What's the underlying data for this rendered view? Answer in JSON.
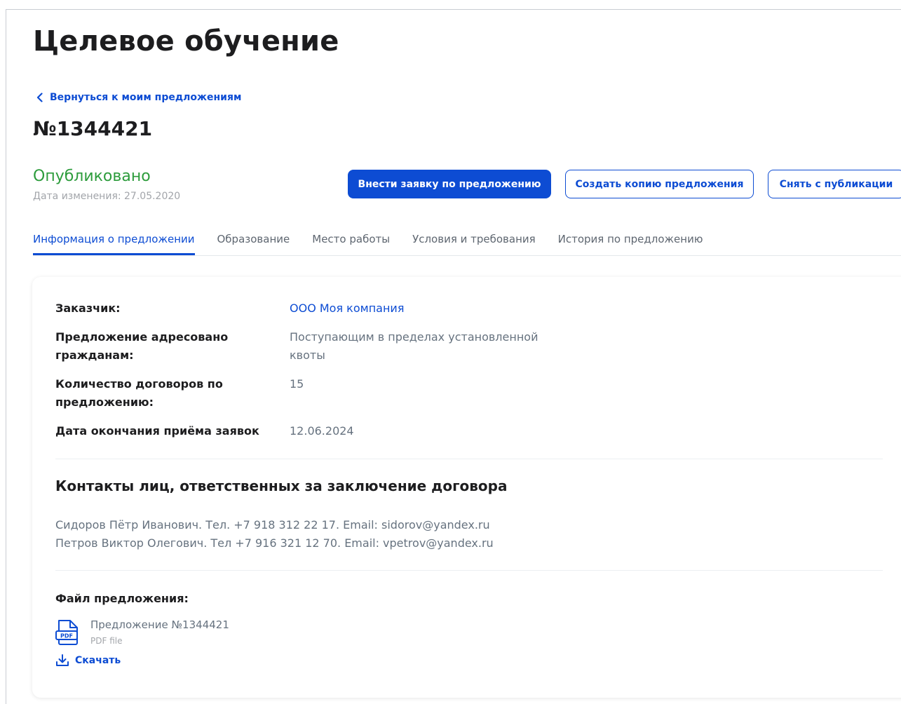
{
  "page": {
    "title": "Целевое обучение",
    "back_link": "Вернуться к моим предложениям",
    "offer_number": "№1344421"
  },
  "status": {
    "label": "Опубликовано",
    "changed_date": "Дата изменения: 27.05.2020",
    "color": "#2d9c3c"
  },
  "actions": {
    "apply": "Внести заявку по предложению",
    "copy": "Создать копию предложения",
    "unpublish": "Снять с публикации"
  },
  "tabs": [
    {
      "label": "Информация о предложении",
      "active": true
    },
    {
      "label": "Образование",
      "active": false
    },
    {
      "label": "Место работы",
      "active": false
    },
    {
      "label": "Условия и требования",
      "active": false
    },
    {
      "label": "История по предложению",
      "active": false
    }
  ],
  "info": {
    "customer": {
      "label": "Заказчик:",
      "value": "ООО Моя компания"
    },
    "addressed": {
      "label": "Предложение адресовано гражданам:",
      "value": "Поступающим в пределах установленной квоты"
    },
    "contracts": {
      "label": "Количество договоров по предложению:",
      "value": "15"
    },
    "deadline": {
      "label": "Дата окончания приёма заявок",
      "value": "12.06.2024"
    }
  },
  "contacts": {
    "title": "Контакты лиц, ответственных за заключение договора",
    "lines": [
      "Сидоров Пётр Иванович. Тел. +7 918 312 22 17. Email: sidorov@yandex.ru",
      "Петров Виктор Олегович. Тел +7 916 321 12 70. Email: vpetrov@yandex.ru"
    ]
  },
  "file": {
    "label": "Файл предложения:",
    "icon": "pdf-file-icon",
    "icon_text": "PDF",
    "name": "Предложение №1344421",
    "type": "PDF file",
    "download": "Скачать"
  },
  "colors": {
    "accent": "#0d4cd3",
    "text": "#1d1d1f",
    "muted": "#66727f"
  }
}
